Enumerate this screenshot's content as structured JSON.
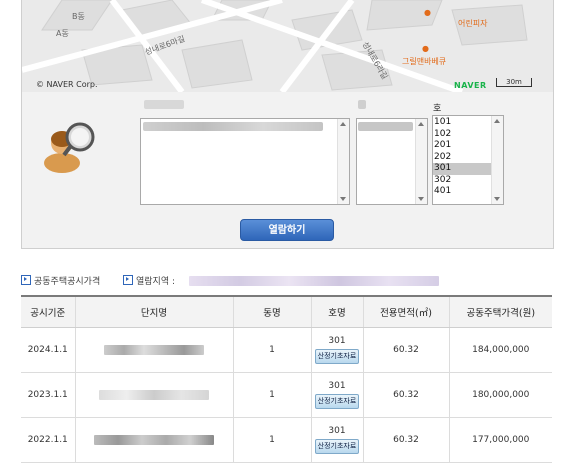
{
  "map": {
    "block_a": "A동",
    "block_b": "B동",
    "road_1": "성내로6마길",
    "road_2": "성내로6라길",
    "poi_1": "어린피자",
    "poi_2": "그릴맨바베큐",
    "copyright": "© NAVER Corp.",
    "brand": "NAVER",
    "scale": "30m"
  },
  "selector": {
    "ho_label": "호",
    "ho_items": [
      "101",
      "102",
      "201",
      "202",
      "301",
      "302",
      "401"
    ],
    "selected_ho": "301",
    "view_button": "열람하기"
  },
  "tabs": {
    "tab1": "공동주택공시가격",
    "tab2_label": "열람지역 :"
  },
  "table": {
    "headers": [
      "공시기준",
      "단지명",
      "동명",
      "호명",
      "전용면적(㎡)",
      "공동주택가격(원)"
    ],
    "doc_button": "산정기초자료",
    "rows": [
      {
        "date": "2024.1.1",
        "dong": "1",
        "ho": "301",
        "area": "60.32",
        "price": "184,000,000"
      },
      {
        "date": "2023.1.1",
        "dong": "1",
        "ho": "301",
        "area": "60.32",
        "price": "180,000,000"
      },
      {
        "date": "2022.1.1",
        "dong": "1",
        "ho": "301",
        "area": "60.32",
        "price": "177,000,000"
      }
    ]
  },
  "colors": {
    "accent": "#2f66b9",
    "naver": "#19b34a",
    "poi": "#e26b1a"
  }
}
